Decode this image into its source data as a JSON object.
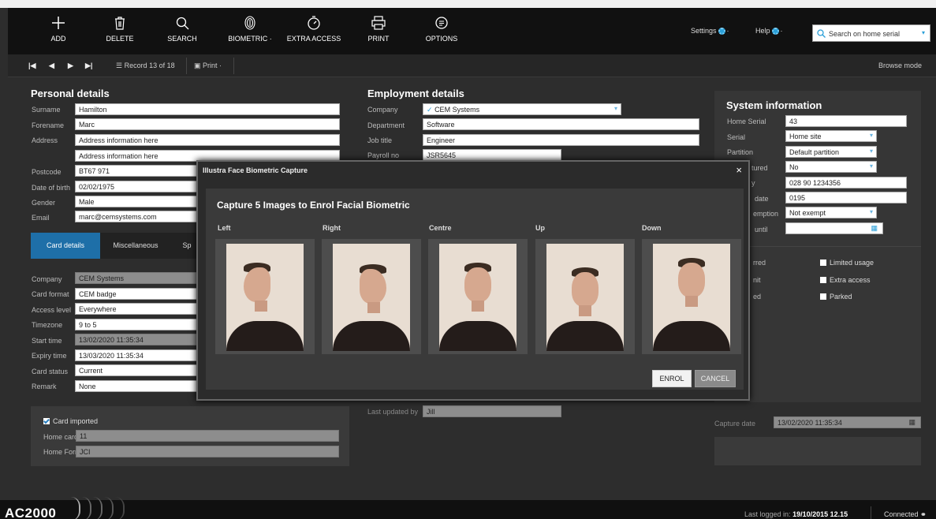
{
  "toolbar": {
    "add": "ADD",
    "delete": "DELETE",
    "search": "SEARCH",
    "biometric": "BIOMETRIC",
    "extra_access": "EXTRA ACCESS",
    "print": "PRINT",
    "options": "OPTIONS",
    "settings": "Settings",
    "help": "Help",
    "search_placeholder": "Search on home serial"
  },
  "subbar": {
    "record": "Record 13 of 18",
    "print": "Print",
    "mode": "Browse mode"
  },
  "personal": {
    "title": "Personal details",
    "surname_label": "Surname",
    "surname": "Hamilton",
    "forename_label": "Forename",
    "forename": "Marc",
    "address_label": "Address",
    "address1": "Address information here",
    "address2": "Address information here",
    "postcode_label": "Postcode",
    "postcode": "BT67 971",
    "dob_label": "Date of birth",
    "dob": "02/02/1975",
    "gender_label": "Gender",
    "gender": "Male",
    "email_label": "Email",
    "email": "marc@cemsystems.com"
  },
  "tabs": [
    "Card details",
    "Miscellaneous",
    "Sp"
  ],
  "card": {
    "company_label": "Company",
    "company": "CEM Systems",
    "format_label": "Card format",
    "format": "CEM badge",
    "access_label": "Access level",
    "access": "Everywhere",
    "timezone_label": "Timezone",
    "timezone": "9 to 5",
    "start_label": "Start time",
    "start": "13/02/2020 11:35:34",
    "expiry_label": "Expiry time",
    "expiry": "13/03/2020 11:35:34",
    "status_label": "Card status",
    "status": "Current",
    "remark_label": "Remark",
    "remark": "None"
  },
  "imported": {
    "label": "Card imported",
    "serial_label": "Home card Serial",
    "serial": "11",
    "format_label": "Home Format",
    "format": "JCI"
  },
  "employment": {
    "title": "Employment details",
    "company_label": "Company",
    "company": "CEM Systems",
    "dept_label": "Department",
    "dept": "Software",
    "job_label": "Job title",
    "job": "Engineer",
    "payroll_label": "Payroll no",
    "payroll": "JSR5645",
    "updated_label": "Last updated by",
    "updated": "Jill"
  },
  "system": {
    "title": "System information",
    "home_serial_label": "Home Serial",
    "home_serial": "43",
    "serial_label": "Serial",
    "serial": "Home site",
    "partition_label": "Partition",
    "partition": "Default partition",
    "row4_label": "tured",
    "row4": "No",
    "row5_label": "y",
    "row5": "028 90 1234356",
    "row6_label": "date",
    "row6": "0195",
    "row7_label": "emption",
    "row7": "Not exempt",
    "row8_label": "until",
    "flag1_label": "rred",
    "flag2_label": "nit",
    "flag3_label": "ed",
    "limited": "Limited usage",
    "extra": "Extra access",
    "parked": "Parked",
    "capture_label": "Capture date",
    "capture": "13/02/2020 11:35:34"
  },
  "dialog": {
    "title": "Illustra Face Biometric Capture",
    "heading": "Capture 5 Images to Enrol Facial Biometric",
    "labels": [
      "Left",
      "Right",
      "Centre",
      "Up",
      "Down"
    ],
    "enrol": "ENROL",
    "cancel": "CANCEL"
  },
  "footer": {
    "logo": "AC2000",
    "last_logged_prefix": "Last logged in:",
    "last_logged": "19/10/2015  12.15",
    "connected": "Connected"
  },
  "colors": {
    "accent": "#1e6fa8",
    "icon_blue": "#2a9fd8"
  }
}
